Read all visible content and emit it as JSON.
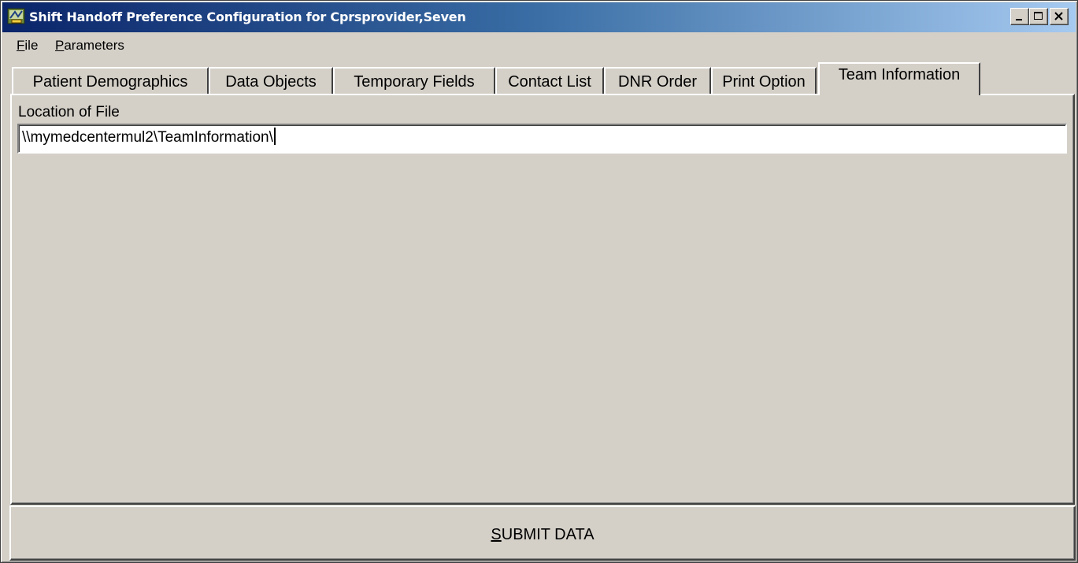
{
  "window": {
    "title": "Shift Handoff Preference Configuration for Cprsprovider,Seven",
    "icon": "app-icon",
    "controls": [
      "minimize-icon",
      "maximize-icon",
      "close-icon"
    ]
  },
  "menu": {
    "items": [
      {
        "label_first": "F",
        "label_rest": "ile"
      },
      {
        "label_first": "P",
        "label_rest": "arameters"
      }
    ]
  },
  "tabs": [
    {
      "label": "Patient Demographics"
    },
    {
      "label": "Data Objects"
    },
    {
      "label": "Temporary Fields"
    },
    {
      "label": "Contact List"
    },
    {
      "label": "DNR Order"
    },
    {
      "label": "Print Option"
    },
    {
      "label": "Team Information",
      "active": true
    }
  ],
  "team_information": {
    "location_label": "Location of File",
    "location_value": "\\\\mymedcentermul2\\TeamInformation\\"
  },
  "submit": {
    "label_first": "S",
    "label_rest": "UBMIT DATA"
  }
}
